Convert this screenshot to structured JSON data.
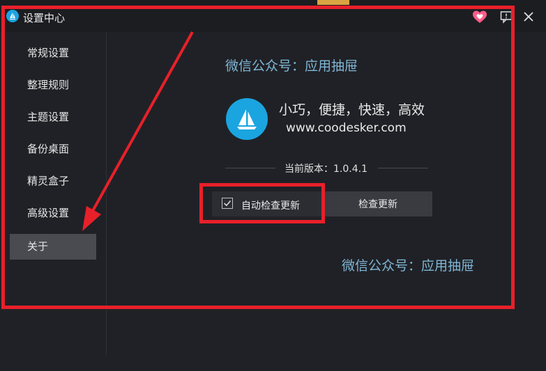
{
  "window": {
    "title": "设置中心"
  },
  "sidebar": {
    "items": [
      {
        "label": "常规设置"
      },
      {
        "label": "整理规则"
      },
      {
        "label": "主题设置"
      },
      {
        "label": "备份桌面"
      },
      {
        "label": "精灵盒子"
      },
      {
        "label": "高级设置"
      },
      {
        "label": "关于",
        "active": true
      }
    ]
  },
  "about": {
    "wechat_top": "微信公众号：应用抽屉",
    "slogan": "小巧，便捷，快速，高效",
    "website": "www.coodesker.com",
    "version_label": "当前版本：1.0.4.1",
    "auto_check_label": "自动检查更新",
    "auto_check_checked": true,
    "check_update_label": "检查更新",
    "wechat_bottom": "微信公众号：应用抽屉"
  },
  "icons": {
    "app_logo": "sailboat-icon",
    "heart": "heart-icon",
    "feedback": "feedback-icon",
    "close": "close-icon"
  },
  "colors": {
    "accent": "#1aa5e0",
    "annotation": "#e8202a",
    "heart": "#ff5c8a",
    "wechat_text": "#7fb7d6"
  }
}
